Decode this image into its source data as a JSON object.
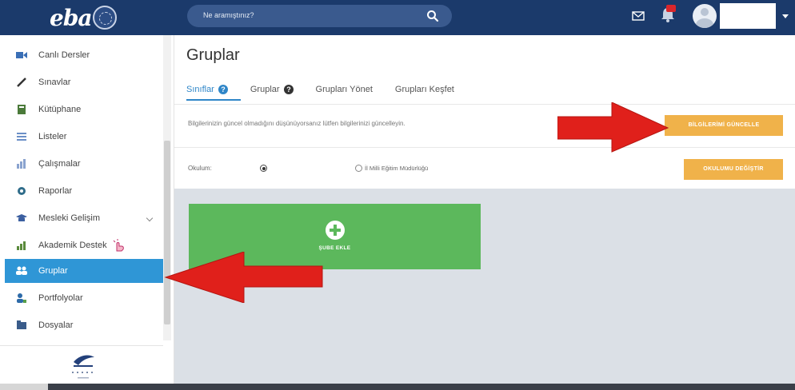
{
  "header": {
    "logo_text": "eba",
    "search_placeholder": "Ne aramıştınız?"
  },
  "sidebar": {
    "items": [
      {
        "label": "Canlı Dersler",
        "icon": "video-camera-icon"
      },
      {
        "label": "Sınavlar",
        "icon": "pencil-icon"
      },
      {
        "label": "Kütüphane",
        "icon": "book-icon"
      },
      {
        "label": "Listeler",
        "icon": "list-icon"
      },
      {
        "label": "Çalışmalar",
        "icon": "chart-icon"
      },
      {
        "label": "Raporlar",
        "icon": "gear-icon"
      },
      {
        "label": "Mesleki Gelişim",
        "icon": "graduation-cap-icon"
      },
      {
        "label": "Akademik Destek",
        "icon": "bar-chart-icon"
      },
      {
        "label": "Gruplar",
        "icon": "users-icon"
      },
      {
        "label": "Portfolyolar",
        "icon": "user-folder-icon"
      },
      {
        "label": "Dosyalar",
        "icon": "folder-icon"
      }
    ],
    "active_item": "Gruplar"
  },
  "main": {
    "title": "Gruplar",
    "tabs": [
      {
        "label": "Sınıflar"
      },
      {
        "label": "Gruplar"
      },
      {
        "label": "Grupları Yönet"
      },
      {
        "label": "Grupları Keşfet"
      }
    ],
    "info_text": "Bilgilerinizin güncel olmadığını düşünüyorsanız lütfen bilgilerinizi güncelleyin.",
    "update_button": "BİLGİLERİMİ GÜNCELLE",
    "school_label": "Okulum:",
    "radio_option_label": "İl Milli Eğitim Müdürlüğü",
    "change_school_button": "OKULUMU DEĞİŞTİR",
    "add_card_label": "ŞUBE EKLE"
  },
  "colors": {
    "topbar": "#1b3a6b",
    "active_sidebar": "#2f96d6",
    "orange_button": "#f0b24a",
    "green_card": "#5cb85c",
    "annotation_arrow": "#e0201b"
  }
}
